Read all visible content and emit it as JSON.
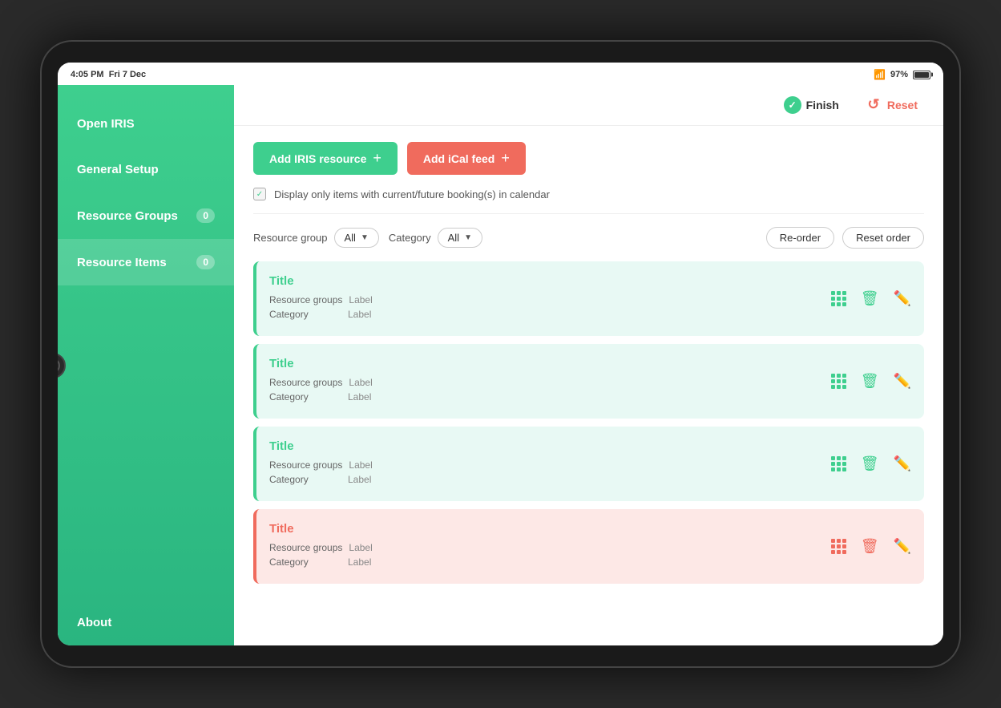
{
  "statusBar": {
    "time": "4:05 PM",
    "date": "Fri 7 Dec",
    "battery": "97%"
  },
  "header": {
    "finishLabel": "Finish",
    "resetLabel": "Reset"
  },
  "buttons": {
    "addIrisResource": "Add IRIS resource",
    "addIcalFeed": "Add iCal feed",
    "plus": "+"
  },
  "checkbox": {
    "label": "Display only items with current/future booking(s) in calendar",
    "checked": true
  },
  "filters": {
    "resourceGroupLabel": "Resource group",
    "resourceGroupValue": "All",
    "categoryLabel": "Category",
    "categoryValue": "All",
    "reorderLabel": "Re-order",
    "resetOrderLabel": "Reset order"
  },
  "sidebar": {
    "items": [
      {
        "label": "Open IRIS",
        "badge": null
      },
      {
        "label": "General Setup",
        "badge": null
      },
      {
        "label": "Resource Groups",
        "badge": "0"
      },
      {
        "label": "Resource Items",
        "badge": "0"
      }
    ],
    "bottom": "About"
  },
  "resourceCards": [
    {
      "type": "teal",
      "title": "Title",
      "metaKey1": "Resource groups",
      "metaVal1": "Label",
      "metaKey2": "Category",
      "metaVal2": "Label"
    },
    {
      "type": "teal",
      "title": "Title",
      "metaKey1": "Resource groups",
      "metaVal1": "Label",
      "metaKey2": "Category",
      "metaVal2": "Label"
    },
    {
      "type": "teal",
      "title": "Title",
      "metaKey1": "Resource groups",
      "metaVal1": "Label",
      "metaKey2": "Category",
      "metaVal2": "Label"
    },
    {
      "type": "coral",
      "title": "Title",
      "metaKey1": "Resource groups",
      "metaVal1": "Label",
      "metaKey2": "Category",
      "metaVal2": "Label"
    }
  ]
}
